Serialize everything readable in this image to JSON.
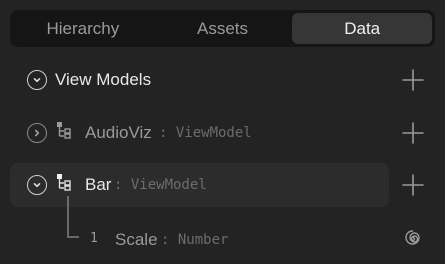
{
  "tabs": [
    {
      "label": "Hierarchy",
      "active": false
    },
    {
      "label": "Assets",
      "active": false
    },
    {
      "label": "Data",
      "active": true
    }
  ],
  "section": {
    "title": "View Models"
  },
  "items": [
    {
      "name": "AudioViz",
      "type": ": ViewModel",
      "expanded": false
    },
    {
      "name": "Bar",
      "type": ": ViewModel",
      "expanded": true,
      "selected": true
    }
  ],
  "properties": [
    {
      "index": "1",
      "name": "Scale",
      "type": ": Number",
      "icon": "spiral-icon"
    }
  ],
  "colors": {
    "background": "#232323",
    "tabbar": "#151515",
    "active_tab": "#363636",
    "selected_row": "#2c2c2c"
  }
}
